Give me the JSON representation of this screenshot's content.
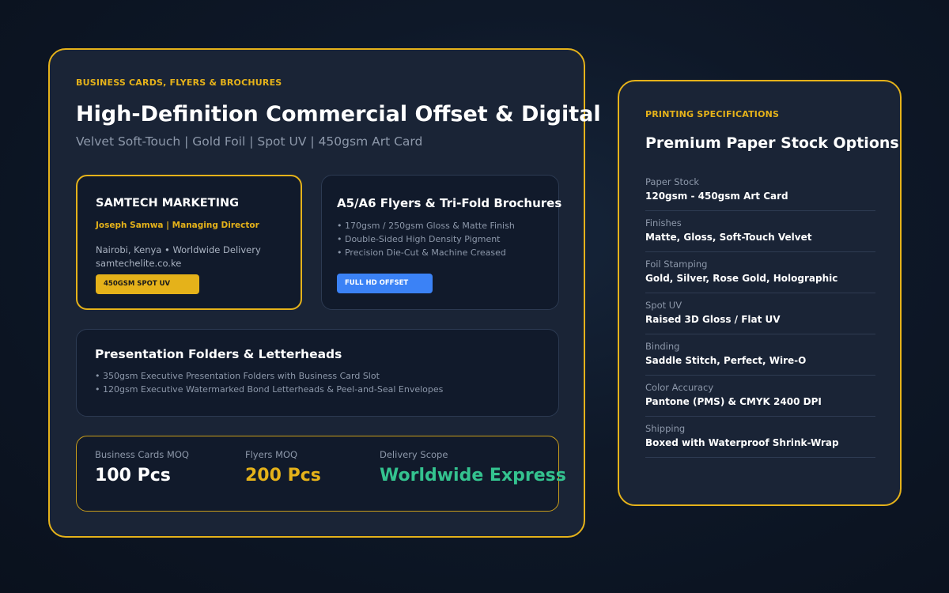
{
  "main": {
    "eyebrow": "BUSINESS CARDS, FLYERS & BROCHURES",
    "title": "High-Definition Commercial Offset & Digital",
    "subtitle": "Velvet Soft-Touch | Gold Foil | Spot UV | 450gsm Art Card"
  },
  "business_card": {
    "company": "SAMTECH MARKETING",
    "person": "Joseph Samwa | Managing Director",
    "location": "Nairobi, Kenya • Worldwide Delivery",
    "website": "samtechelite.co.ke",
    "badge": "450GSM SPOT UV",
    "badge_color": "#e5b21a"
  },
  "flyers": {
    "title": "A5/A6 Flyers & Tri-Fold Brochures",
    "bullets": [
      "• 170gsm / 250gsm Gloss & Matte Finish",
      "• Double-Sided High Density Pigment",
      "• Precision Die-Cut & Machine Creased"
    ],
    "badge": "FULL HD OFFSET",
    "badge_color": "#3b82f6"
  },
  "folders": {
    "title": "Presentation Folders & Letterheads",
    "bullets": [
      "• 350gsm Executive Presentation Folders with Business Card Slot",
      "• 120gsm Executive Watermarked Bond Letterheads & Peel-and-Seal Envelopes"
    ]
  },
  "stats": [
    {
      "label": "Business Cards MOQ",
      "value": "100 Pcs"
    },
    {
      "label": "Flyers MOQ",
      "value": "200 Pcs"
    },
    {
      "label": "Delivery Scope",
      "value": "Worldwide Express"
    }
  ],
  "specs": {
    "eyebrow": "PRINTING SPECIFICATIONS",
    "title": "Premium Paper Stock Options",
    "rows": [
      {
        "label": "Paper Stock",
        "value": "120gsm - 450gsm Art Card"
      },
      {
        "label": "Finishes",
        "value": "Matte, Gloss, Soft-Touch Velvet"
      },
      {
        "label": "Foil Stamping",
        "value": "Gold, Silver, Rose Gold, Holographic"
      },
      {
        "label": "Spot UV",
        "value": "Raised 3D Gloss / Flat UV"
      },
      {
        "label": "Binding",
        "value": "Saddle Stitch, Perfect, Wire-O"
      },
      {
        "label": "Color Accuracy",
        "value": "Pantone (PMS) & CMYK 2400 DPI"
      },
      {
        "label": "Shipping",
        "value": "Boxed with Waterproof Shrink-Wrap"
      }
    ]
  },
  "colors": {
    "accent": "#e5b21a",
    "success": "#34c38f",
    "info": "#3b82f6",
    "background": "#0e1828",
    "card": "#1a2436"
  }
}
